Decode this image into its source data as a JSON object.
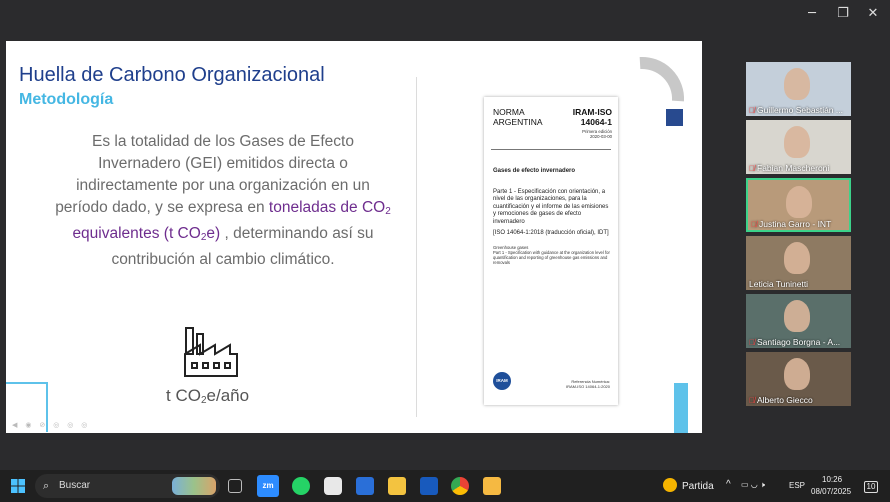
{
  "window": {
    "minimize": "─",
    "restore": "❐",
    "close": "✕"
  },
  "slide": {
    "title": "Huella de Carbono Organizacional",
    "subtitle": "Metodología",
    "body": {
      "p1": "Es la totalidad de los Gases de Efecto Invernadero (GEI) emitidos directa o indirectamente por una organización en un período dado, y se expresa en",
      "highlight_a": "toneladas de CO",
      "sub_a": "2",
      "highlight_b": " equivalentes (t CO",
      "sub_b": "2",
      "highlight_c": "e)",
      "p2": ", determinando así su contribución al cambio climático."
    },
    "unit_pre": "t CO",
    "unit_sub": "2",
    "unit_post": "e/año",
    "icon": "factory-icon",
    "document": {
      "norma": "NORMA",
      "country": "ARGENTINA",
      "code1": "IRAM-ISO",
      "code2": "14064-1",
      "edition": "Primera edición",
      "edition_date": "2020-03-00",
      "heading": "Gases de efecto invernadero",
      "part": "Parte 1 - Especificación con orientación, a nivel de las organizaciones, para la cuantificación y el informe de las emisiones y remociones de gases de efecto invernadero",
      "iso_ref": "[ISO 14064-1:2018 (traducción oficial), IDT]",
      "en_title": "Greenhouse gases",
      "en_part": "Part 1 - Specification with guidance at the organization level for quantification and reporting of greenhouse gas emissions and removals",
      "logo": "IRAM",
      "ref_label": "Referencia Numérica:",
      "ref_value": "IRAM-ISO 14064-1:2020"
    },
    "accent_colors": {
      "title": "#1f3f8c",
      "subtitle": "#45b7e3",
      "highlight": "#6e2d8e"
    }
  },
  "participants": [
    {
      "name": "Guillermo Sebastián ...",
      "muted": true
    },
    {
      "name": "Fabian Mascheroni",
      "muted": true
    },
    {
      "name": "Justina Garro - INT",
      "muted": true,
      "active": true
    },
    {
      "name": "Leticia Tuninetti",
      "muted": false
    },
    {
      "name": "Santiago Borgna - A...",
      "muted": true
    },
    {
      "name": "Alberto Giecco",
      "muted": true
    }
  ],
  "taskbar": {
    "search_placeholder": "Buscar",
    "weather": "Partida",
    "lang": "ESP",
    "time": "10:26",
    "date": "08/07/2025",
    "notifications": "10"
  }
}
